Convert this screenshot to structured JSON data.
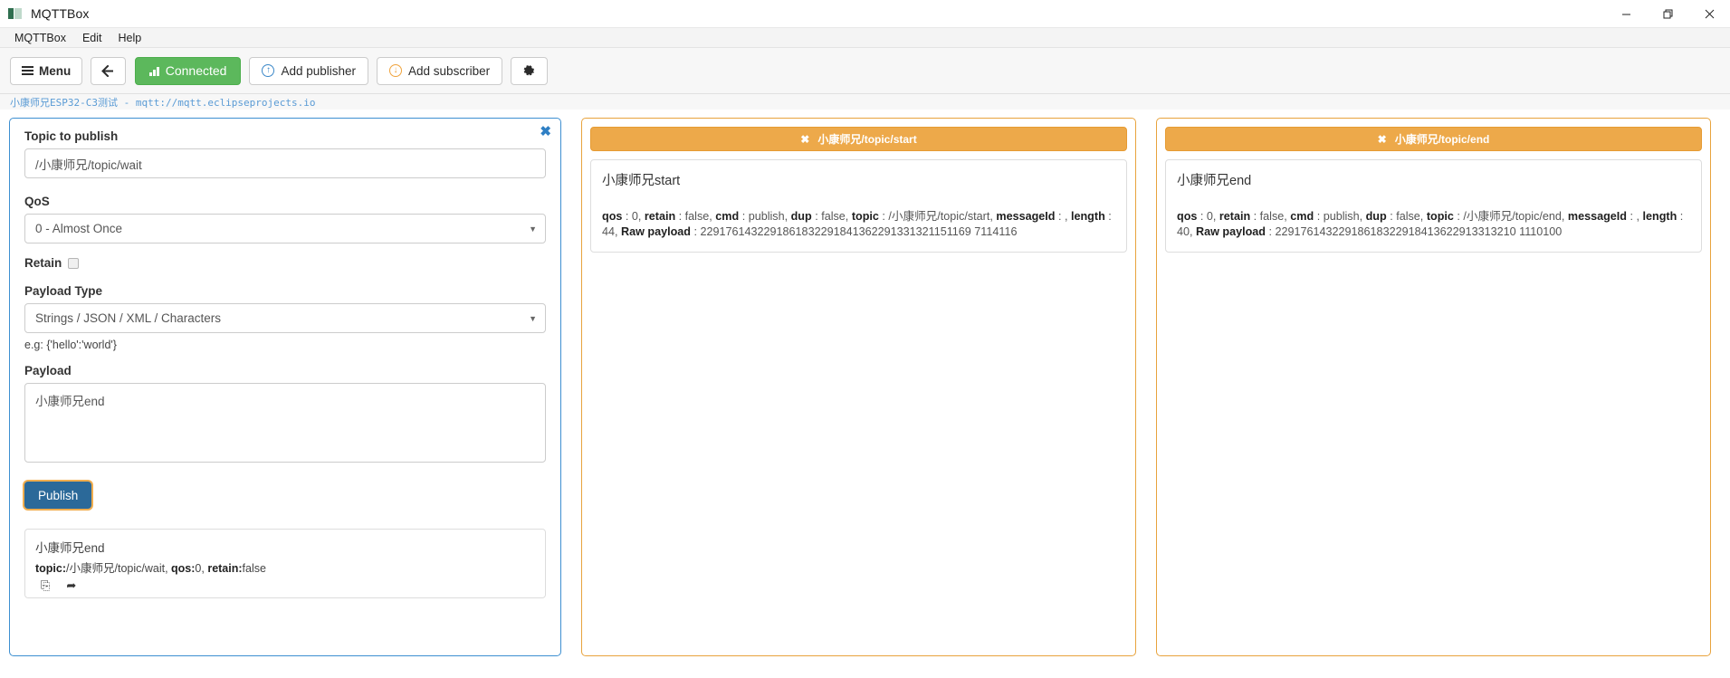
{
  "window": {
    "title": "MQTTBox",
    "app_icon": "mqttbox-logo-icon",
    "minimize_label": "–",
    "maximize_label": "❐",
    "close_label": "✕"
  },
  "menubar": {
    "items": [
      {
        "label": "MQTTBox"
      },
      {
        "label": "Edit"
      },
      {
        "label": "Help"
      }
    ]
  },
  "toolbar": {
    "menu_label": "Menu",
    "back_label": "←",
    "connected_label": "Connected",
    "add_publisher_label": "Add publisher",
    "add_subscriber_label": "Add subscriber",
    "settings_label": "⚙"
  },
  "breadcrumb": {
    "text": "小康师兄ESP32-C3测试  -  mqtt://mqtt.eclipseprojects.io"
  },
  "publisher": {
    "close_label": "✖",
    "topic_label": "Topic to publish",
    "topic_value": "/小康师兄/topic/wait",
    "topic_placeholder": "Topic to publish",
    "qos_label": "QoS",
    "qos_value": "0 - Almost Once",
    "qos_caret": "▼",
    "retain_label": "Retain",
    "retain_checked": false,
    "payload_type_label": "Payload Type",
    "payload_type_value": "Strings / JSON / XML / Characters",
    "payload_type_caret": "▼",
    "payload_type_hint": "e.g: {'hello':'world'}",
    "payload_label": "Payload",
    "payload_value": "小康师兄end",
    "payload_placeholder": "Payload",
    "publish_label": "Publish",
    "history": [
      {
        "message": "小康师兄end",
        "meta_topic_key": "topic:",
        "meta_topic_value": "/小康师兄/topic/wait, ",
        "meta_qos_key": "qos:",
        "meta_qos_value": "0, ",
        "meta_retain_key": "retain:",
        "meta_retain_value": "false",
        "copy_icon": "⎘",
        "forward_icon": "➦"
      }
    ]
  },
  "subscribers": [
    {
      "header_close": "✖",
      "header_topic": "小康师兄/topic/start",
      "message_title": "小康师兄start",
      "detail": {
        "qos_key": "qos",
        "qos_value": " : 0, ",
        "retain_key": "retain",
        "retain_value": " : false, ",
        "cmd_key": "cmd",
        "cmd_value": " : publish, ",
        "dup_key": "dup",
        "dup_value": " : false, ",
        "topic_key": "topic",
        "topic_value": " : /小康师兄/topic/start, ",
        "messageid_key": "messageId",
        "messageid_value": " : , ",
        "length_key": "length",
        "length_value": " : 44, ",
        "rawpayload_key": "Raw payload",
        "rawpayload_value": " : 2291761432291861832291841362291331321151169 7114116"
      }
    },
    {
      "header_close": "✖",
      "header_topic": "小康师兄/topic/end",
      "message_title": "小康师兄end",
      "detail": {
        "qos_key": "qos",
        "qos_value": " : 0, ",
        "retain_key": "retain",
        "retain_value": " : false, ",
        "cmd_key": "cmd",
        "cmd_value": " : publish, ",
        "dup_key": "dup",
        "dup_value": " : false, ",
        "topic_key": "topic",
        "topic_value": " : /小康师兄/topic/end, ",
        "messageid_key": "messageId",
        "messageid_value": " : , ",
        "length_key": "length",
        "length_value": " : 40, ",
        "rawpayload_key": "Raw payload",
        "rawpayload_value": " : 22917614322918618322918413622913313210 1110100"
      }
    }
  ],
  "colors": {
    "connected_green": "#5cb85c",
    "publisher_blue": "#3d8fd1",
    "subscriber_orange": "#eda94a",
    "publish_button_blue": "#2b6999",
    "focus_ring_orange": "#f0ad4e",
    "breadcrumb_blue": "#5a9bd5"
  }
}
